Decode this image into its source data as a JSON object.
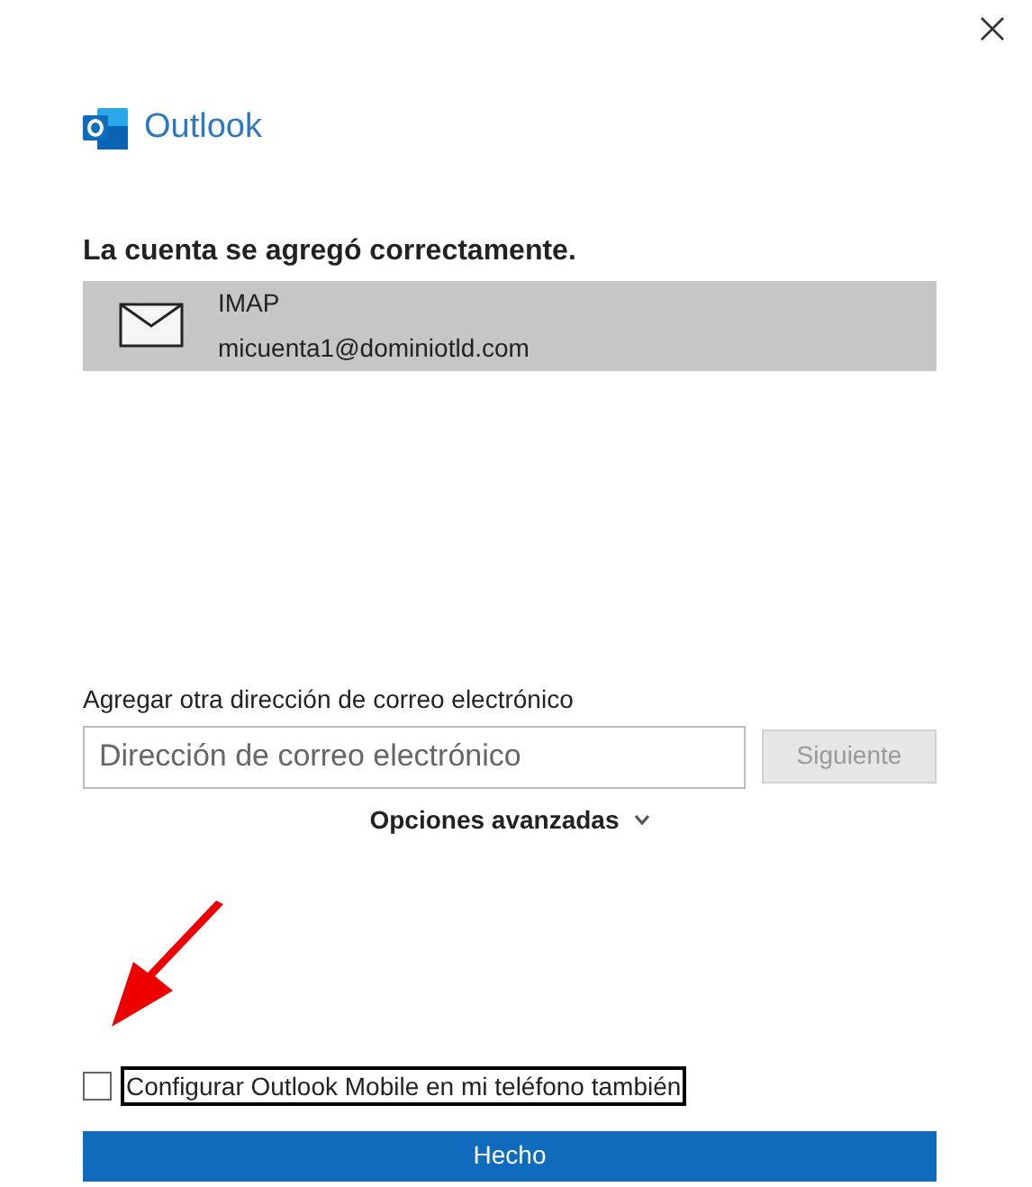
{
  "brand": "Outlook",
  "heading": "La cuenta se agregó correctamente.",
  "account": {
    "type": "IMAP",
    "email": "micuenta1@dominiotld.com"
  },
  "add_another": {
    "label": "Agregar otra dirección de correo electrónico",
    "placeholder": "Dirección de correo electrónico",
    "next_button": "Siguiente",
    "next_disabled": true
  },
  "advanced": {
    "label": "Opciones avanzadas",
    "expanded": false
  },
  "mobile_checkbox": {
    "label": "Configurar Outlook Mobile en mi teléfono también",
    "checked": false
  },
  "done_button": "Hecho"
}
